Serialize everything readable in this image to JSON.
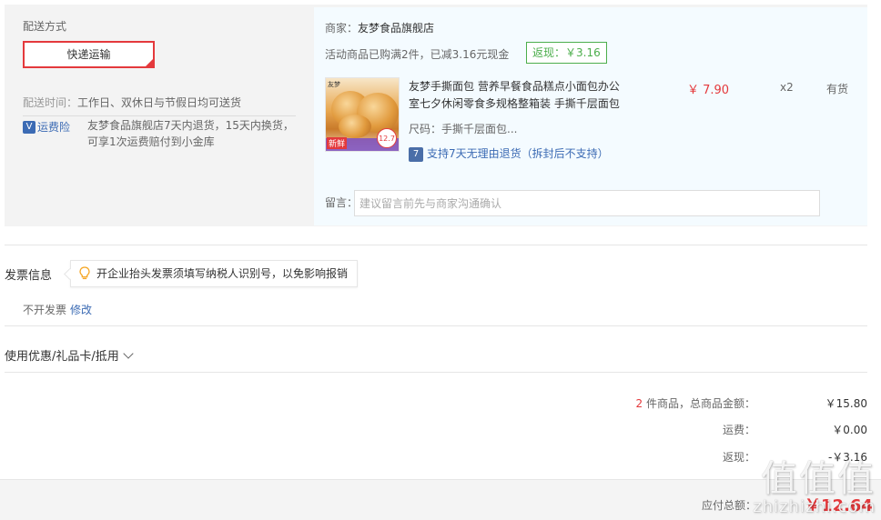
{
  "shipping": {
    "title": "配送方式",
    "method": "快递运输",
    "time_label": "配送时间：",
    "time_value": "工作日、双休日与节假日均可送货",
    "insurance_icon": "shield-v-icon",
    "insurance_label": "运费险",
    "insurance_desc": "友梦食品旗舰店7天内退货，15天内换货，可享1次运费赔付到小金库"
  },
  "shop": {
    "merchant_label": "商家：",
    "merchant_name": "友梦食品旗舰店",
    "promo_text": "活动商品已购满2件，已减3.16元现金",
    "rebate_badge": "返现：￥3.16"
  },
  "product": {
    "title": "友梦手撕面包 营养早餐食品糕点小面包办公室七夕休闲零食多规格整箱装 手撕千层面包",
    "price": "￥ 7.90",
    "qty": "x2",
    "stock": "有货",
    "size": "尺码：手撕千层面包...",
    "return_policy": "支持7天无理由退货（拆封后不支持）",
    "image_tag": "新鲜",
    "image_price": "12.7",
    "image_logo": "友梦"
  },
  "message": {
    "label": "留言：",
    "placeholder": "建议留言前先与商家沟通确认"
  },
  "invoice": {
    "title": "发票信息",
    "tip": "开企业抬头发票须填写纳税人识别号，以免影响报销",
    "status": "不开发票",
    "edit": "修改"
  },
  "coupon": {
    "label": "使用优惠/礼品卡/抵用"
  },
  "summary": {
    "count": "2",
    "goods_label": " 件商品，总商品金额：",
    "goods_total": "￥15.80",
    "freight_label": "运费：",
    "freight": "￥0.00",
    "rebate_label": "返现：",
    "rebate": "-￥3.16",
    "pay_label": "应付总额：",
    "pay_total": "￥12.64"
  },
  "watermark": {
    "top": "值值值",
    "bottom": "zhizhizhi.com"
  },
  "colors": {
    "accent_red": "#e4393c",
    "link_blue": "#3c6bb4",
    "rebate_green": "#4cae4c",
    "shop_panel_bg": "#f4fbff",
    "ship_panel_bg": "#f3f3f3"
  }
}
